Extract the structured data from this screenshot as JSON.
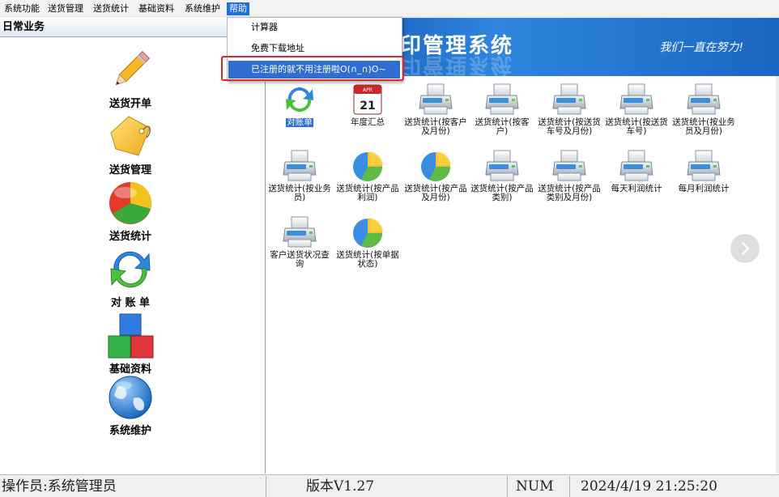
{
  "menubar": {
    "items": [
      {
        "label": "系统功能"
      },
      {
        "label": "送货管理"
      },
      {
        "label": "送货统计"
      },
      {
        "label": "基础资料"
      },
      {
        "label": "系统维护"
      },
      {
        "label": "帮助",
        "active": true
      }
    ]
  },
  "help_menu": {
    "items": [
      {
        "label": "计算器"
      },
      {
        "label": "免费下载地址"
      },
      {
        "label": "已注册的就不用注册啦O(∩_∩)O~",
        "highlighted": true
      }
    ]
  },
  "left_panel": {
    "title": "日常业务",
    "items": [
      {
        "label": "送货开单",
        "icon": "pencil-icon"
      },
      {
        "label": "送货管理",
        "icon": "tag-icon"
      },
      {
        "label": "送货统计",
        "icon": "pie-chart-icon"
      },
      {
        "label": "对 账 单",
        "icon": "refresh-icon"
      },
      {
        "label": "基础资料",
        "icon": "blocks-icon"
      },
      {
        "label": "系统维护",
        "icon": "globe-icon"
      }
    ]
  },
  "banner": {
    "title_visible": "印管理系统",
    "slogan": "我们一直在努力!"
  },
  "functions": {
    "items": [
      {
        "label": "对账单",
        "icon": "refresh-icon",
        "selected": true
      },
      {
        "label": "年度汇总",
        "icon": "calendar-icon",
        "calendar_month": "APR",
        "calendar_day": "21"
      },
      {
        "label": "送货统计(按客户及月份)",
        "icon": "printer-icon"
      },
      {
        "label": "送货统计(按客户)",
        "icon": "printer-icon"
      },
      {
        "label": "送货统计(按送货车号及月份)",
        "icon": "printer-icon"
      },
      {
        "label": "送货统计(按送货车号)",
        "icon": "printer-icon"
      },
      {
        "label": "送货统计(按业务员及月份)",
        "icon": "printer-icon"
      },
      {
        "label": "送货统计(按业务员)",
        "icon": "printer-icon"
      },
      {
        "label": "送货统计(按产品利润)",
        "icon": "pie-chart-icon"
      },
      {
        "label": "送货统计(按产品及月份)",
        "icon": "pie-chart-icon"
      },
      {
        "label": "送货统计(按产品类别)",
        "icon": "printer-icon"
      },
      {
        "label": "送货统计(按产品类别及月份)",
        "icon": "printer-icon"
      },
      {
        "label": "每天利润统计",
        "icon": "printer-icon"
      },
      {
        "label": "每月利润统计",
        "icon": "printer-icon"
      },
      {
        "label": "客户送货状况查询",
        "icon": "printer-icon"
      },
      {
        "label": "送货统计(按单据状态)",
        "icon": "pie-chart-icon"
      }
    ]
  },
  "statusbar": {
    "operator": "操作员:系统管理员",
    "version": "版本V1.27",
    "num": "NUM",
    "datetime": "2024/4/19 21:25:20"
  },
  "colors": {
    "menu_active": "#1e6fd9",
    "banner_blue": "#2f86de",
    "highlight_blue": "#2f6ed1",
    "outline_red": "#e0262b"
  }
}
